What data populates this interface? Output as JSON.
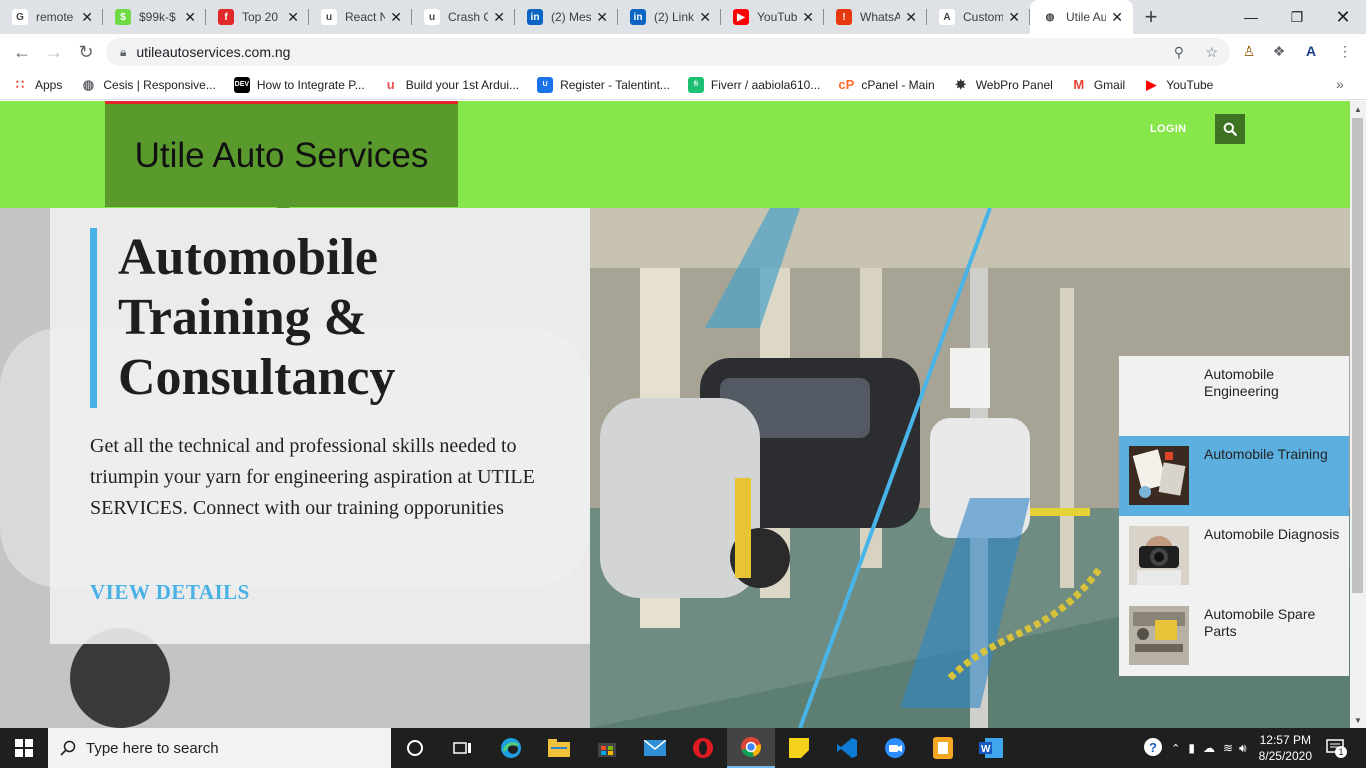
{
  "browser": {
    "tabs": [
      {
        "label": "remote",
        "icon": "google-icon",
        "color": "#ffffff",
        "glyph": "G"
      },
      {
        "label": "$99k-$",
        "icon": "upwork-icon",
        "color": "#6fda44",
        "glyph": "$"
      },
      {
        "label": "Top 20",
        "icon": "flipboard-icon",
        "color": "#e12828",
        "glyph": "f"
      },
      {
        "label": "React N",
        "icon": "udemy-icon",
        "color": "#ffffff",
        "glyph": "u"
      },
      {
        "label": "Crash C",
        "icon": "udemy-icon",
        "color": "#ffffff",
        "glyph": "u"
      },
      {
        "label": "(2) Mes",
        "icon": "linkedin-icon",
        "color": "#0a66c2",
        "glyph": "in"
      },
      {
        "label": "(2) Link",
        "icon": "linkedin-icon",
        "color": "#0a66c2",
        "glyph": "in"
      },
      {
        "label": "YouTub",
        "icon": "youtube-icon",
        "color": "#ff0000",
        "glyph": "▶"
      },
      {
        "label": "WhatsA",
        "icon": "alert-icon",
        "color": "#e8380d",
        "glyph": "!"
      },
      {
        "label": "Custom",
        "icon": "autofill-icon",
        "color": "#ffffff",
        "glyph": "A"
      },
      {
        "label": "Utile Au",
        "icon": "globe-icon",
        "color": "#ffffff",
        "glyph": "◍"
      }
    ],
    "active_tab": 10,
    "url": "utileautoservices.com.ng",
    "bookmarks": [
      {
        "label": "Apps",
        "icon": "apps-grid-icon"
      },
      {
        "label": "Cesis | Responsive...",
        "icon": "globe-icon"
      },
      {
        "label": "How to Integrate P...",
        "icon": "dev-icon"
      },
      {
        "label": "Build your 1st Ardui...",
        "icon": "udemy-icon"
      },
      {
        "label": "Register - Talentint...",
        "icon": "talent-icon"
      },
      {
        "label": "Fiverr / aabiola610...",
        "icon": "fiverr-icon"
      },
      {
        "label": "cPanel - Main",
        "icon": "cpanel-icon"
      },
      {
        "label": "WebPro Panel",
        "icon": "webpro-icon"
      },
      {
        "label": "Gmail",
        "icon": "gmail-icon"
      },
      {
        "label": "YouTube",
        "icon": "youtube-icon"
      }
    ]
  },
  "site": {
    "brand": "Utile Auto Services",
    "login": "LOGIN",
    "hero": {
      "title": "Automobile Training & Consultancy",
      "body": "Get all the technical and professional skills needed to triumpin your yarn for engineering aspiration at UTILE SERVICES. Connect with our training opporunities",
      "link": "VIEW DETAILS"
    },
    "services": [
      {
        "label": "Automobile Engineering",
        "active": false
      },
      {
        "label": "Automobile Training",
        "active": true
      },
      {
        "label": "Automobile Diagnosis",
        "active": false
      },
      {
        "label": "Automobile Spare Parts",
        "active": false
      }
    ]
  },
  "taskbar": {
    "search_placeholder": "Type here to search",
    "time": "12:57 PM",
    "date": "8/25/2020",
    "notifications": "1"
  },
  "colors": {
    "header_green": "#86e64a",
    "brand_green": "#5a9a2c",
    "accent_blue": "#4ab1e6",
    "active_service": "#5cb0e0"
  }
}
